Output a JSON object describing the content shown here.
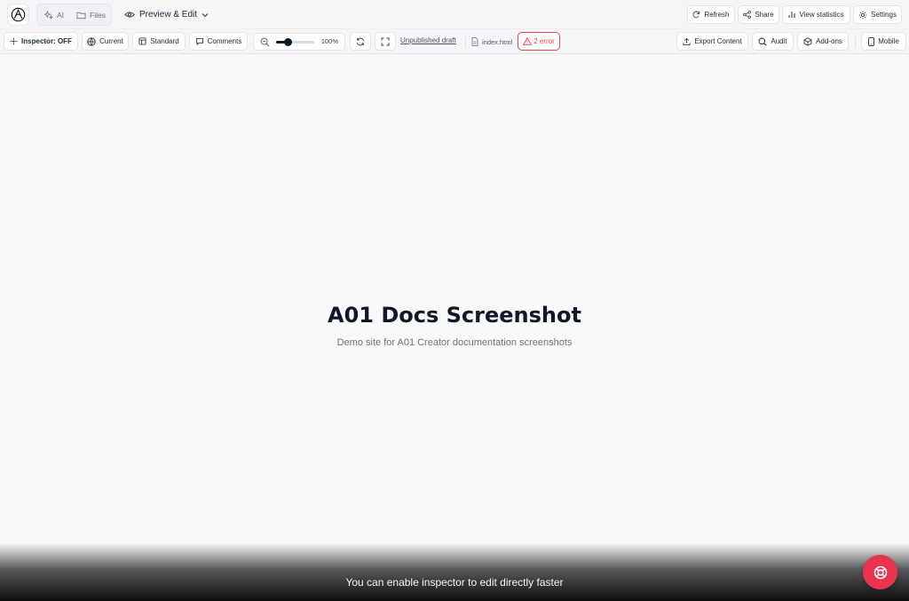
{
  "topbar": {
    "segments": [
      {
        "label": "AI",
        "icon": "sparkles-icon"
      },
      {
        "label": "Files",
        "icon": "folder-icon"
      }
    ],
    "view_mode": {
      "label": "Preview & Edit",
      "icon": "eye-icon"
    },
    "actions": [
      {
        "label": "Refresh",
        "icon": "refresh-icon"
      },
      {
        "label": "Share",
        "icon": "share-icon"
      },
      {
        "label": "View statistics",
        "icon": "bar-chart-icon"
      },
      {
        "label": "Settings",
        "icon": "gear-icon"
      }
    ]
  },
  "toolbar": {
    "inspector_label": "Inspector: OFF",
    "current_label": "Current",
    "standard_label": "Standard",
    "comments_label": "Comments",
    "zoom": {
      "value_pct": 100,
      "label": "100%",
      "slider_fraction": 0.3
    },
    "draft_link": "Unpublished draft",
    "file_name": "index.html",
    "error_label": "2 error",
    "export_label": "Export Content",
    "audit_label": "Audit",
    "addons_label": "Add-ons",
    "device_label": "Mobile"
  },
  "preview": {
    "title": "A01 Docs Screenshot",
    "subtitle": "Demo site for A01 Creator documentation screenshots"
  },
  "footer": {
    "hint": "You can enable inspector to edit directly faster"
  },
  "colors": {
    "accent_red": "#e8344f",
    "error_red": "#ef4444",
    "page_bg": "#f8f9fb"
  }
}
